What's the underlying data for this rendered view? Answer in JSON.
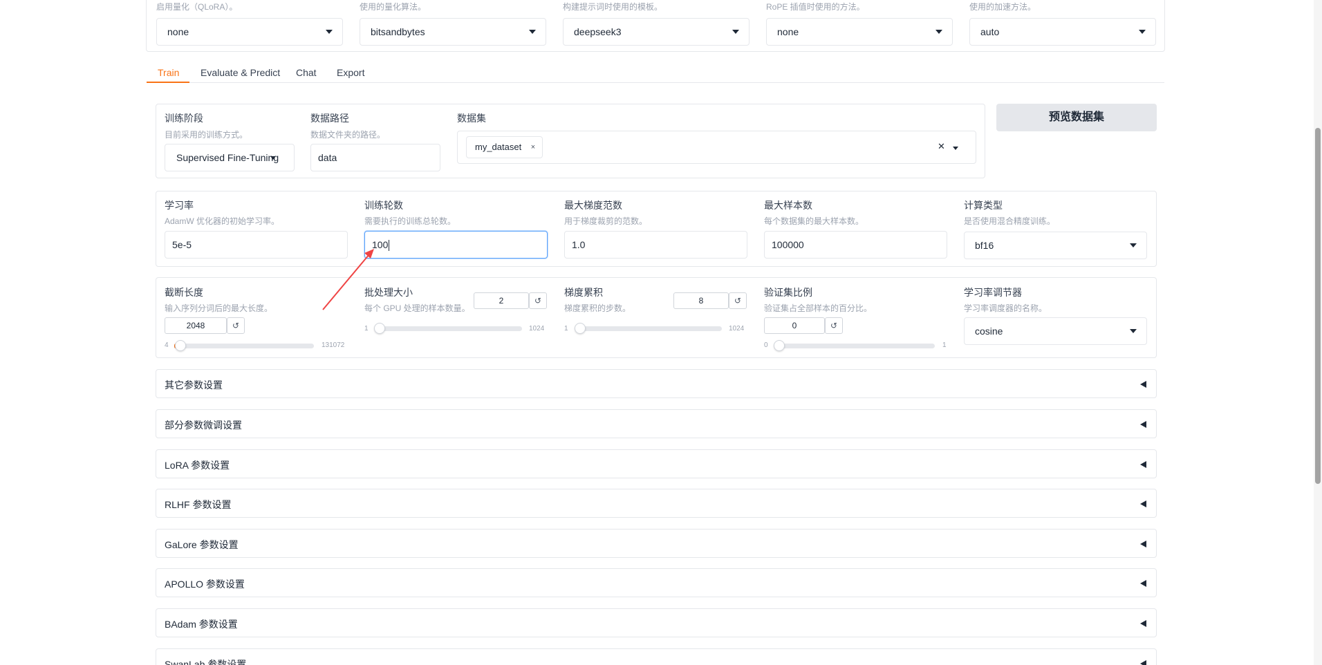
{
  "top": {
    "fields": [
      {
        "desc": "启用量化（QLoRA）。",
        "value": "none"
      },
      {
        "desc": "使用的量化算法。",
        "value": "bitsandbytes"
      },
      {
        "desc": "构建提示词时使用的模板。",
        "value": "deepseek3"
      },
      {
        "desc": "RoPE 插值时使用的方法。",
        "value": "none"
      },
      {
        "desc": "使用的加速方法。",
        "value": "auto"
      }
    ]
  },
  "tabs": [
    {
      "label": "Train"
    },
    {
      "label": "Evaluate & Predict"
    },
    {
      "label": "Chat"
    },
    {
      "label": "Export"
    }
  ],
  "stage": {
    "label": "训练阶段",
    "info": "目前采用的训练方式。",
    "value": "Supervised Fine-Tuning"
  },
  "dataset_dir": {
    "label": "数据路径",
    "info": "数据文件夹的路径。",
    "value": "data"
  },
  "dataset": {
    "label": "数据集",
    "chip": "my_dataset",
    "remove": "×",
    "clear": "✕"
  },
  "preview_button": "预览数据集",
  "row2": [
    {
      "label": "学习率",
      "info": "AdamW 优化器的初始学习率。",
      "value": "5e-5"
    },
    {
      "label": "训练轮数",
      "info": "需要执行的训练总轮数。",
      "value": "100"
    },
    {
      "label": "最大梯度范数",
      "info": "用于梯度裁剪的范数。",
      "value": "1.0"
    },
    {
      "label": "最大样本数",
      "info": "每个数据集的最大样本数。",
      "value": "100000"
    },
    {
      "label": "计算类型",
      "info": "是否使用混合精度训练。",
      "value": "bf16"
    }
  ],
  "row3": {
    "cutoff": {
      "label": "截断长度",
      "info": "输入序列分词后的最大长度。",
      "value": "2048",
      "min": "4",
      "max": "131072",
      "fraction": 0.0156
    },
    "batch": {
      "label": "批处理大小",
      "info": "每个 GPU 处理的样本数量。",
      "value": "2",
      "min": "1",
      "max": "1024",
      "fraction": 0.001
    },
    "grad_accum": {
      "label": "梯度累积",
      "info": "梯度累积的步数。",
      "value": "8",
      "min": "1",
      "max": "1024",
      "fraction": 0.007
    },
    "val_size": {
      "label": "验证集比例",
      "info": "验证集占全部样本的百分比。",
      "value": "0",
      "min": "0",
      "max": "1",
      "fraction": 0
    },
    "scheduler": {
      "label": "学习率调节器",
      "info": "学习率调度器的名称。",
      "value": "cosine"
    }
  },
  "reset_glyph": "↺",
  "accordions": [
    {
      "label": "其它参数设置"
    },
    {
      "label": "部分参数微调设置"
    },
    {
      "label": "LoRA 参数设置"
    },
    {
      "label": "RLHF 参数设置"
    },
    {
      "label": "GaLore 参数设置"
    },
    {
      "label": "APOLLO 参数设置"
    },
    {
      "label": "BAdam 参数设置"
    },
    {
      "label": "SwanLab 参数设置"
    }
  ],
  "colors": {
    "accent": "#f97316",
    "annotation": "#ef4444",
    "focus": "#60a5fa"
  }
}
